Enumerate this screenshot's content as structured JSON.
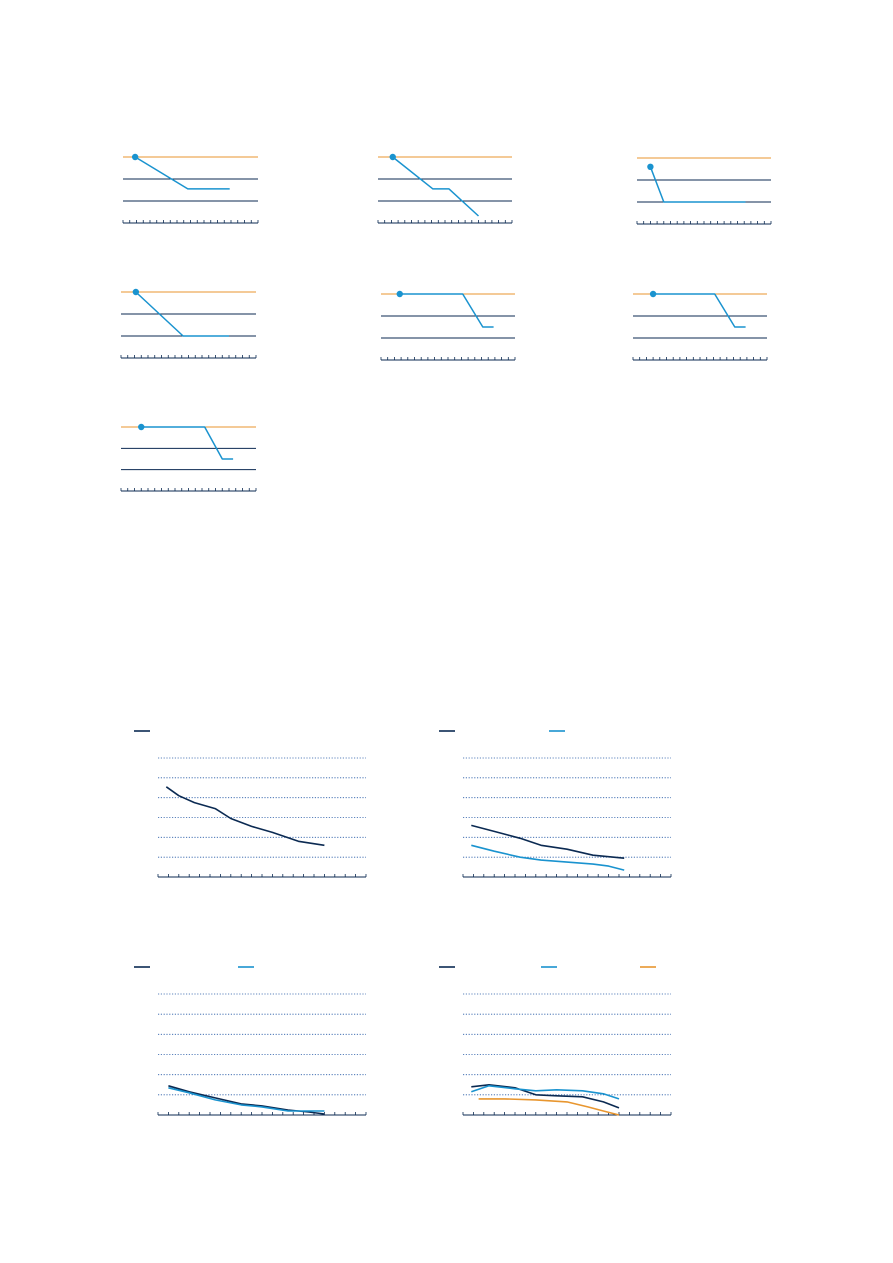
{
  "colors": {
    "navy": "#0b2a52",
    "cyan": "#1a93cf",
    "orange": "#e8962f"
  },
  "chart_data": [
    {
      "type": "line",
      "panel": "small-multiple-1",
      "grid": false,
      "x_range": [
        0,
        10
      ],
      "y_range": [
        0,
        3
      ],
      "tick_count": 21,
      "reference_lines": [
        {
          "y": 3,
          "color": "orange"
        },
        {
          "y": 2,
          "color": "navy"
        },
        {
          "y": 1,
          "color": "navy"
        }
      ],
      "series": [
        {
          "color": "cyan",
          "marker_at_start": true,
          "x": [
            0.9,
            4.8,
            7.9
          ],
          "y": [
            3,
            1.55,
            1.55
          ]
        }
      ]
    },
    {
      "type": "line",
      "panel": "small-multiple-2",
      "grid": false,
      "x_range": [
        0,
        10
      ],
      "y_range": [
        0,
        3
      ],
      "tick_count": 21,
      "reference_lines": [
        {
          "y": 3,
          "color": "orange"
        },
        {
          "y": 2,
          "color": "navy"
        },
        {
          "y": 1,
          "color": "navy"
        }
      ],
      "series": [
        {
          "color": "cyan",
          "marker_at_start": true,
          "x": [
            1.1,
            4.1,
            5.3,
            7.5
          ],
          "y": [
            3,
            1.55,
            1.55,
            0.32
          ]
        }
      ]
    },
    {
      "type": "line",
      "panel": "small-multiple-3",
      "grid": false,
      "x_range": [
        0,
        10
      ],
      "y_range": [
        0,
        3
      ],
      "tick_count": 21,
      "reference_lines": [
        {
          "y": 3,
          "color": "orange"
        },
        {
          "y": 2,
          "color": "navy"
        },
        {
          "y": 1,
          "color": "navy"
        }
      ],
      "series": [
        {
          "color": "cyan",
          "marker_at_start": true,
          "x": [
            1.0,
            2.0,
            8.1
          ],
          "y": [
            2.6,
            1.0,
            1.0
          ]
        }
      ]
    },
    {
      "type": "line",
      "panel": "small-multiple-4",
      "grid": false,
      "x_range": [
        0,
        10
      ],
      "y_range": [
        0,
        3
      ],
      "tick_count": 21,
      "reference_lines": [
        {
          "y": 3,
          "color": "orange"
        },
        {
          "y": 2,
          "color": "navy"
        },
        {
          "y": 1,
          "color": "navy"
        }
      ],
      "series": [
        {
          "color": "cyan",
          "marker_at_start": true,
          "x": [
            1.1,
            4.6,
            8.0
          ],
          "y": [
            3,
            1.0,
            1.0
          ]
        }
      ]
    },
    {
      "type": "line",
      "panel": "small-multiple-5",
      "grid": false,
      "x_range": [
        0,
        10
      ],
      "y_range": [
        0,
        3
      ],
      "tick_count": 21,
      "reference_lines": [
        {
          "y": 3,
          "color": "orange"
        },
        {
          "y": 2,
          "color": "navy"
        },
        {
          "y": 1,
          "color": "navy"
        }
      ],
      "series": [
        {
          "color": "cyan",
          "marker_at_start": true,
          "x": [
            1.4,
            6.1,
            7.6,
            8.4
          ],
          "y": [
            3,
            3,
            1.5,
            1.5
          ]
        }
      ]
    },
    {
      "type": "line",
      "panel": "small-multiple-6",
      "grid": false,
      "x_range": [
        0,
        10
      ],
      "y_range": [
        0,
        3
      ],
      "tick_count": 21,
      "reference_lines": [
        {
          "y": 3,
          "color": "orange"
        },
        {
          "y": 2,
          "color": "navy"
        },
        {
          "y": 1,
          "color": "navy"
        }
      ],
      "series": [
        {
          "color": "cyan",
          "marker_at_start": true,
          "x": [
            1.5,
            6.1,
            7.6,
            8.4
          ],
          "y": [
            3,
            3,
            1.5,
            1.5
          ]
        }
      ]
    },
    {
      "type": "line",
      "panel": "small-multiple-7",
      "grid": false,
      "x_range": [
        0,
        10
      ],
      "y_range": [
        0,
        3
      ],
      "tick_count": 21,
      "reference_lines": [
        {
          "y": 3,
          "color": "orange"
        },
        {
          "y": 2,
          "color": "navy"
        },
        {
          "y": 1,
          "color": "navy"
        }
      ],
      "series": [
        {
          "color": "cyan",
          "marker_at_start": true,
          "x": [
            1.5,
            6.2,
            7.5,
            8.3
          ],
          "y": [
            3,
            3,
            1.5,
            1.5
          ]
        }
      ]
    },
    {
      "type": "line",
      "panel": "large-chart-1",
      "grid": true,
      "x_range": [
        0,
        20
      ],
      "y_range": [
        0,
        6
      ],
      "tick_count": 21,
      "legend": {
        "placement": "top-left",
        "entries": [
          {
            "color": "navy"
          }
        ]
      },
      "series": [
        {
          "color": "navy",
          "x": [
            0.8,
            2,
            3.5,
            5.5,
            7,
            9,
            11,
            13.5,
            16
          ],
          "y": [
            4.55,
            4.1,
            3.75,
            3.45,
            2.95,
            2.55,
            2.25,
            1.8,
            1.6
          ]
        }
      ]
    },
    {
      "type": "line",
      "panel": "large-chart-2",
      "grid": true,
      "x_range": [
        0,
        20
      ],
      "y_range": [
        0,
        6
      ],
      "tick_count": 21,
      "legend": {
        "placement": "top-left",
        "entries": [
          {
            "color": "navy"
          },
          {
            "color": "cyan"
          }
        ]
      },
      "series": [
        {
          "color": "navy",
          "x": [
            0.8,
            3,
            5.5,
            7.5,
            10,
            12.5,
            15.5
          ],
          "y": [
            2.6,
            2.3,
            1.95,
            1.6,
            1.4,
            1.1,
            0.95
          ]
        },
        {
          "color": "cyan",
          "x": [
            0.8,
            3,
            5.5,
            7.5,
            10,
            12.5,
            14,
            15.5
          ],
          "y": [
            1.6,
            1.3,
            1.0,
            0.85,
            0.75,
            0.65,
            0.55,
            0.35
          ]
        }
      ]
    },
    {
      "type": "line",
      "panel": "large-chart-3",
      "grid": true,
      "x_range": [
        0,
        20
      ],
      "y_range": [
        0,
        6
      ],
      "tick_count": 21,
      "legend": {
        "placement": "top-left",
        "entries": [
          {
            "color": "navy"
          },
          {
            "color": "cyan"
          }
        ]
      },
      "series": [
        {
          "color": "navy",
          "x": [
            1,
            3,
            5.5,
            8,
            10,
            12.5,
            14.5,
            16
          ],
          "y": [
            1.45,
            1.15,
            0.85,
            0.55,
            0.45,
            0.25,
            0.15,
            0.05
          ]
        },
        {
          "color": "cyan",
          "x": [
            1,
            3,
            5.5,
            8,
            10,
            12.5,
            14.5,
            16
          ],
          "y": [
            1.35,
            1.1,
            0.75,
            0.5,
            0.4,
            0.2,
            0.2,
            0.2
          ]
        }
      ]
    },
    {
      "type": "line",
      "panel": "large-chart-4",
      "grid": true,
      "x_range": [
        0,
        20
      ],
      "y_range": [
        0,
        6
      ],
      "tick_count": 21,
      "legend": {
        "placement": "top",
        "entries": [
          {
            "color": "navy"
          },
          {
            "color": "cyan"
          },
          {
            "color": "orange"
          }
        ]
      },
      "series": [
        {
          "color": "navy",
          "x": [
            0.8,
            2.5,
            5,
            7,
            9,
            11.5,
            13.5,
            15
          ],
          "y": [
            1.4,
            1.5,
            1.35,
            1.0,
            0.95,
            0.9,
            0.65,
            0.35
          ]
        },
        {
          "color": "cyan",
          "x": [
            0.8,
            2.5,
            5,
            7,
            9,
            11.5,
            13.5,
            15
          ],
          "y": [
            1.15,
            1.45,
            1.3,
            1.2,
            1.25,
            1.2,
            1.05,
            0.8
          ]
        },
        {
          "color": "orange",
          "x": [
            1.5,
            4,
            7,
            10,
            12,
            13.5,
            15
          ],
          "y": [
            0.8,
            0.8,
            0.75,
            0.65,
            0.4,
            0.2,
            0.0
          ]
        }
      ]
    }
  ]
}
